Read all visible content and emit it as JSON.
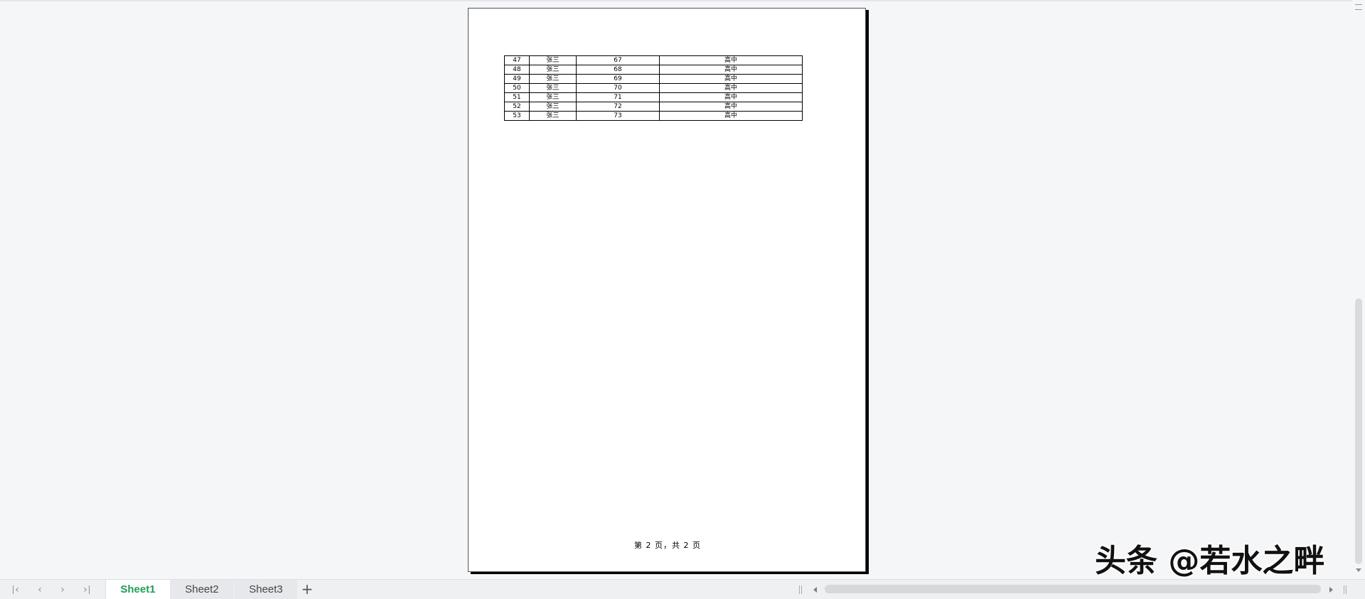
{
  "sheet_table": {
    "rows": [
      [
        "47",
        "张三",
        "67",
        "高中"
      ],
      [
        "48",
        "张三",
        "68",
        "高中"
      ],
      [
        "49",
        "张三",
        "69",
        "高中"
      ],
      [
        "50",
        "张三",
        "70",
        "高中"
      ],
      [
        "51",
        "张三",
        "71",
        "高中"
      ],
      [
        "52",
        "张三",
        "72",
        "高中"
      ],
      [
        "53",
        "张三",
        "73",
        "高中"
      ]
    ]
  },
  "page_footer": "第 2 页，共 2 页",
  "watermark": "头条 @若水之畔",
  "sheet_tabs": [
    {
      "label": "Sheet1",
      "active": true
    },
    {
      "label": "Sheet2",
      "active": false
    },
    {
      "label": "Sheet3",
      "active": false
    }
  ],
  "icons": {
    "nav_first": "first-sheet-icon",
    "nav_prev": "previous-sheet-icon",
    "nav_next": "next-sheet-icon",
    "nav_last": "last-sheet-icon",
    "add_sheet": "plus-icon",
    "scroll_left": "arrow-left-icon",
    "scroll_right": "arrow-right-icon",
    "scroll_down": "arrow-down-icon"
  },
  "colors": {
    "active_tab_text": "#1e9e5a",
    "background": "#f5f6f8"
  }
}
